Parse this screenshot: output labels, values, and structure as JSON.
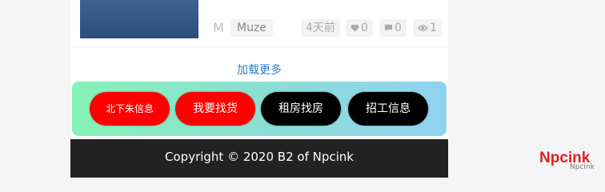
{
  "post": {
    "author_initial": "M",
    "author": "Muze",
    "time": "4天前",
    "likes": "0",
    "comments": "0",
    "views": "1"
  },
  "load_more": "加载更多",
  "banner_links": [
    {
      "label": "北下朱信息",
      "color": "#ff0000"
    },
    {
      "label": "我要找货",
      "color": "#ff0000"
    },
    {
      "label": "租房找房",
      "color": "#000000"
    },
    {
      "label": "招工信息",
      "color": "#000000"
    }
  ],
  "footer": {
    "copyright": "Copyright © 2020 B2 of Npcink"
  },
  "brand": {
    "logo_text": "Npcink",
    "caption": "Npcink"
  },
  "colors": {
    "link": "#2a7fd4",
    "footer_bg": "#222222",
    "banner_start": "#85f2b5",
    "banner_end": "#8fd2f0"
  }
}
